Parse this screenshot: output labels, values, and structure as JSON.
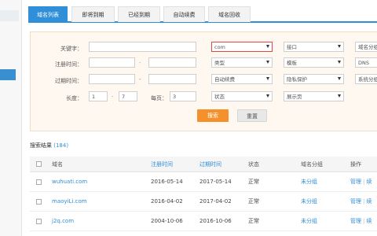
{
  "tabs": [
    "域名列表",
    "即将到期",
    "已经到期",
    "自动续费",
    "域名回收"
  ],
  "filter": {
    "keyword_label": "关键字：",
    "reg_time_label": "注册时间：",
    "exp_time_label": "过期时间：",
    "length_label": "长度：",
    "per_page_label": "每页：",
    "dash": "-",
    "length_min": "1",
    "length_max": "7",
    "per_page": "3",
    "select_suffix": "com",
    "select_type": "类型",
    "select_renew": "自动续费",
    "select_status": "状态",
    "select_interface": "接口",
    "select_template": "模板",
    "select_privacy": "隐私保护",
    "select_display": "展示页",
    "select_group": "域名分组",
    "select_dns": "DNS",
    "select_sysgroup": "系统分组",
    "search_label": "搜索",
    "reset_label": "重置"
  },
  "results": {
    "title": "搜索结果",
    "count": "(184)"
  },
  "table": {
    "headers": {
      "name": "域名",
      "reg": "注册时间",
      "exp": "过期时间",
      "status": "状态",
      "group": "域名分组",
      "ops": "操作"
    },
    "rows": [
      {
        "domain": "wuhuati.com",
        "reg": "2016-05-14",
        "exp": "2017-05-14",
        "status": "正常",
        "group": "未分组",
        "op1": "管理",
        "op2": "续"
      },
      {
        "domain": "maoyiLi.com",
        "reg": "2016-04-02",
        "exp": "2017-04-02",
        "status": "正常",
        "group": "未分组",
        "op1": "管理",
        "op2": "续"
      },
      {
        "domain": "j2q.com",
        "reg": "2004-10-06",
        "exp": "2016-10-06",
        "status": "正常",
        "group": "未分组",
        "op1": "管理",
        "op2": "续"
      }
    ]
  },
  "colors": {
    "accent": "#2f8fd8",
    "search_button": "#f5912a",
    "filter_bg": "#fff8f0",
    "required_red": "#e04848"
  }
}
